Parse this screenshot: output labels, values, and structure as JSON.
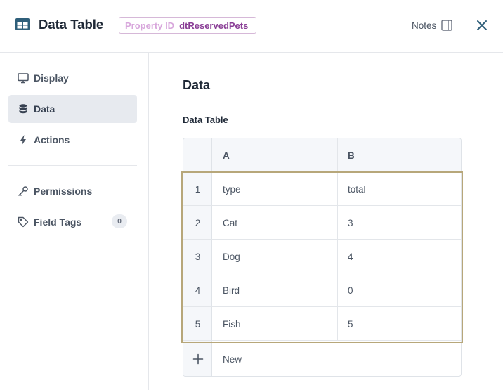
{
  "header": {
    "title": "Data Table",
    "title_icon": "table-icon",
    "property_label": "Property ID",
    "property_value": "dtReservedPets",
    "notes_label": "Notes",
    "notes_icon": "panel-icon",
    "close_icon": "close-icon"
  },
  "sidebar": {
    "items": [
      {
        "label": "Display",
        "icon": "monitor-icon",
        "active": false
      },
      {
        "label": "Data",
        "icon": "database-icon",
        "active": true
      },
      {
        "label": "Actions",
        "icon": "lightning-icon",
        "active": false
      },
      {
        "label": "Permissions",
        "icon": "key-icon",
        "active": false
      },
      {
        "label": "Field Tags",
        "icon": "tag-icon",
        "active": false,
        "count": "0"
      }
    ]
  },
  "main": {
    "title": "Data",
    "section_label": "Data Table",
    "table": {
      "columns": [
        "A",
        "B"
      ],
      "rows": [
        {
          "num": "1",
          "a": "type",
          "b": "total"
        },
        {
          "num": "2",
          "a": "Cat",
          "b": "3"
        },
        {
          "num": "3",
          "a": "Dog",
          "b": "4"
        },
        {
          "num": "4",
          "a": "Bird",
          "b": "0"
        },
        {
          "num": "5",
          "a": "Fish",
          "b": "5"
        }
      ],
      "new_label": "New"
    }
  },
  "colors": {
    "accent": "#2f5f7a",
    "property_value": "#8a3e96",
    "highlight_border": "#b7a77a"
  }
}
